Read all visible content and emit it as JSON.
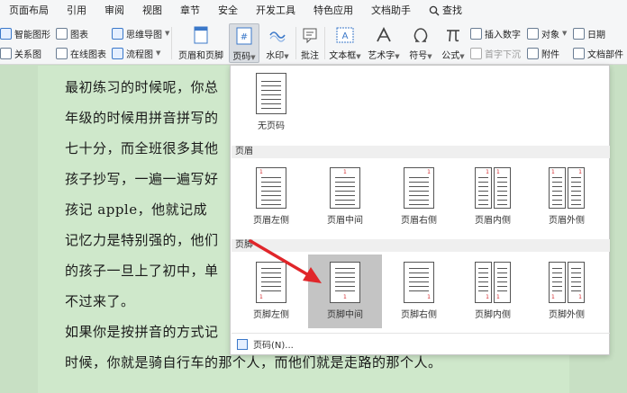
{
  "menu": {
    "tabs": [
      "页面布局",
      "引用",
      "审阅",
      "视图",
      "章节",
      "安全",
      "开发工具",
      "特色应用",
      "文档助手"
    ],
    "search_label": "查找"
  },
  "toolbar": {
    "smart_shape": "智能图形",
    "chart": "图表",
    "mind_map": "思维导图",
    "relation": "关系图",
    "online_chart": "在线图表",
    "flowchart": "流程图",
    "header_footer": "页眉和页脚",
    "page_number": "页码",
    "watermark": "水印",
    "comment": "批注",
    "textbox": "文本框",
    "art_text": "艺术字",
    "symbol": "符号",
    "formula": "公式",
    "insert_number": "插入数字",
    "object": "对象",
    "date": "日期",
    "drop_cap": "首字下沉",
    "attachment": "附件",
    "doc_parts": "文档部件"
  },
  "document": {
    "lines": [
      "最初练习的时候呢，你总",
      "年级的时候用拼音拼写的",
      "七十分，而全班很多其他",
      "孩子抄写，一遍一遍写好",
      "孩记 apple，他就记成",
      "记忆力是特别强的，他们",
      "的孩子一旦上了初中，单",
      "不过来了。",
      "如果你是按拼音的方式记",
      "时候，你就是骑自行车的那个人，而他们就是走路的那个人。"
    ]
  },
  "page_number_menu": {
    "none_label": "无页码",
    "header_section": "页眉",
    "header_options": [
      "页眉左侧",
      "页眉中间",
      "页眉右侧",
      "页眉内侧",
      "页眉外侧"
    ],
    "footer_section": "页脚",
    "footer_options": [
      "页脚左侧",
      "页脚中间",
      "页脚右侧",
      "页脚内侧",
      "页脚外侧"
    ],
    "more_label": "页码(N)...",
    "thumb_number": "1"
  },
  "colors": {
    "accent": "#1a64c8",
    "arrow": "#e0262a",
    "hover": "#c4c4c4",
    "page": "#cfe8cb"
  }
}
